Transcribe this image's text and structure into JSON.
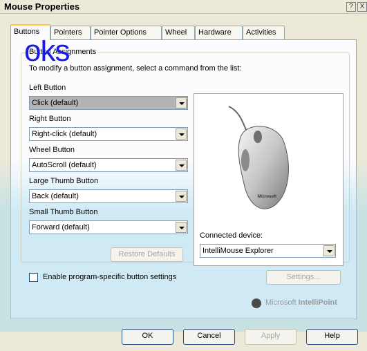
{
  "window": {
    "title": "Mouse Properties",
    "help_btn": "?",
    "close_btn": "X"
  },
  "tabs": [
    {
      "label": "Buttons",
      "active": true
    },
    {
      "label": "Pointers"
    },
    {
      "label": "Pointer Options"
    },
    {
      "label": "Wheel"
    },
    {
      "label": "Hardware"
    },
    {
      "label": "Activities"
    }
  ],
  "watermark": "oks",
  "group": {
    "title": "Button Assignments",
    "instruction": "To modify a button assignment, select a command from the list:"
  },
  "fields": [
    {
      "label": "Left Button",
      "value": "Click (default)"
    },
    {
      "label": "Right Button",
      "value": "Right-click (default)"
    },
    {
      "label": "Wheel Button",
      "value": "AutoScroll (default)"
    },
    {
      "label": "Large Thumb Button",
      "value": "Back (default)"
    },
    {
      "label": "Small Thumb Button",
      "value": "Forward (default)"
    }
  ],
  "restore_defaults": "Restore Defaults",
  "connected_device": {
    "label": "Connected device:",
    "value": "IntelliMouse Explorer"
  },
  "checkbox": {
    "label": "Enable program-specific button settings",
    "checked": false
  },
  "settings_btn": "Settings...",
  "brand": {
    "prefix": "Microsoft",
    "name": "IntelliPoint"
  },
  "footer": {
    "ok": "OK",
    "cancel": "Cancel",
    "apply": "Apply",
    "help": "Help"
  }
}
